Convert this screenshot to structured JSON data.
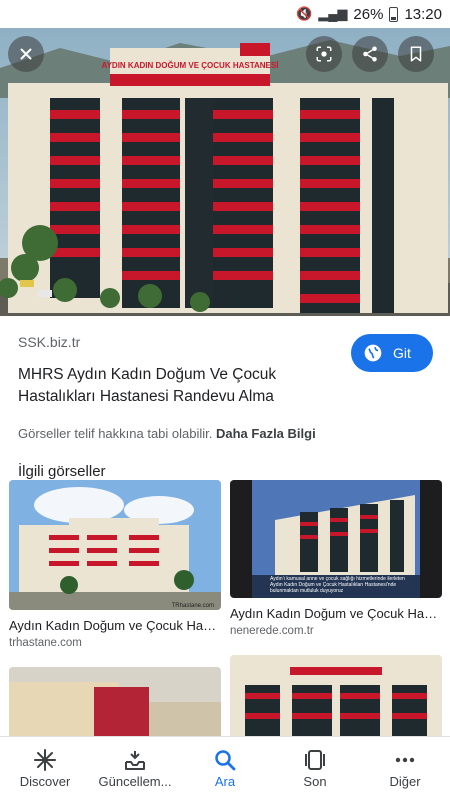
{
  "status_bar": {
    "battery_percent": "26%",
    "time": "13:20"
  },
  "hero": {
    "sign_text": "AYDIN KADIN DOĞUM VE ÇOCUK HASTANESİ",
    "buttons": [
      "close-icon",
      "lens-icon",
      "share-icon",
      "bookmark-icon"
    ]
  },
  "result": {
    "source": "SSK.biz.tr",
    "title": "MHRS Aydın Kadın Doğum Ve Çocuk Hastalıkları Hastanesi Randevu Alma",
    "visit_label": "Git",
    "copyright_text": "Görseller telif hakkına tabi olabilir.",
    "more_info_label": "Daha Fazla Bilgi"
  },
  "related": {
    "heading": "İlgili görseller",
    "items": [
      {
        "title": "Aydın Kadın Doğum ve Çocuk Hast...",
        "site": "trhastane.com",
        "watermark": "TRhastane.com"
      },
      {
        "title": "Aydın Kadın Doğum ve Çocuk Hast...",
        "site": "nenerede.com.tr",
        "caption": "Aydın'ı kamusal anne ve çocuk sağlığı hizmetlerinde ilerleten Aydın Kadın Doğum ve Çocuk Hastalıkları Hastanesi'nde bulunmaktan mutluluk duyuyoruz"
      },
      {
        "title": "",
        "site": ""
      },
      {
        "title": "",
        "site": ""
      }
    ]
  },
  "bottom_nav": {
    "items": [
      {
        "label": "Discover",
        "icon": "asterisk-icon"
      },
      {
        "label": "Güncellem...",
        "icon": "updates-icon"
      },
      {
        "label": "Ara",
        "icon": "search-icon",
        "active": true
      },
      {
        "label": "Son",
        "icon": "recent-tabs-icon"
      },
      {
        "label": "Diğer",
        "icon": "more-icon"
      }
    ]
  },
  "colors": {
    "accent": "#1a73e8",
    "building_red": "#c8172a",
    "building_cream": "#ece4d3"
  }
}
